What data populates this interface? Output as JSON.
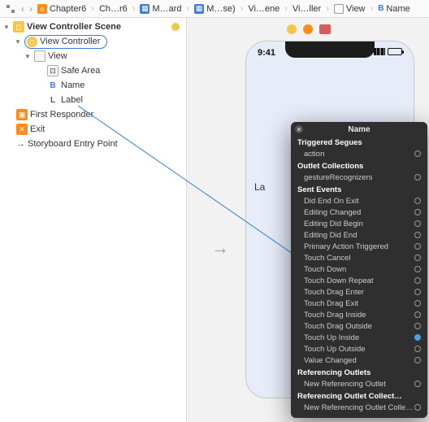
{
  "breadcrumbs": {
    "b0": "Chapter6",
    "b1": "Ch…r6",
    "b2": "M…ard",
    "b3": "M…se)",
    "b4": "Vi…ene",
    "b5": "Vi…ller",
    "b6": "View",
    "b7": "Name"
  },
  "outline": {
    "scene": "View Controller Scene",
    "vc": "View Controller",
    "view": "View",
    "safe_area": "Safe Area",
    "name": "Name",
    "label": "Label",
    "first_responder": "First Responder",
    "exit": "Exit",
    "entry": "Storyboard Entry Point"
  },
  "device": {
    "time": "9:41",
    "label": "La"
  },
  "popover": {
    "title": "Name",
    "sect_triggered": "Triggered Segues",
    "action": "action",
    "sect_outletcol": "Outlet Collections",
    "gesture": "gestureRecognizers",
    "sect_sent": "Sent Events",
    "events": {
      "e0": "Did End On Exit",
      "e1": "Editing Changed",
      "e2": "Editing Did Begin",
      "e3": "Editing Did End",
      "e4": "Primary Action Triggered",
      "e5": "Touch Cancel",
      "e6": "Touch Down",
      "e7": "Touch Down Repeat",
      "e8": "Touch Drag Enter",
      "e9": "Touch Drag Exit",
      "e10": "Touch Drag Inside",
      "e11": "Touch Drag Outside",
      "e12": "Touch Up Inside",
      "e13": "Touch Up Outside",
      "e14": "Value Changed"
    },
    "sect_refout": "Referencing Outlets",
    "newref": "New Referencing Outlet",
    "sect_refcol": "Referencing Outlet Collect…",
    "newrefcol": "New Referencing Outlet Colle…"
  }
}
